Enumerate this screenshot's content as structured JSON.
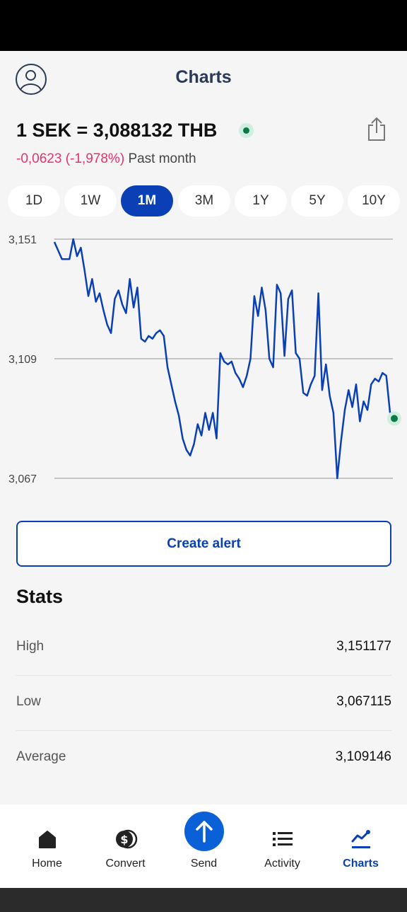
{
  "header": {
    "title": "Charts"
  },
  "rate": {
    "text": "1 SEK = 3,088132 THB",
    "change": "-0,0623 (-1,978%)",
    "period": "Past month",
    "change_color": "#e8336a",
    "live_color": "#0b7a45"
  },
  "range_tabs": [
    {
      "label": "1D",
      "active": false
    },
    {
      "label": "1W",
      "active": false
    },
    {
      "label": "1M",
      "active": true
    },
    {
      "label": "3M",
      "active": false
    },
    {
      "label": "1Y",
      "active": false
    },
    {
      "label": "5Y",
      "active": false
    },
    {
      "label": "10Y",
      "active": false
    }
  ],
  "chart_data": {
    "type": "line",
    "title": "",
    "xlabel": "",
    "ylabel": "",
    "ylim": [
      3.067,
      3.151
    ],
    "y_ticks": [
      "3,151",
      "3,109",
      "3,067"
    ],
    "y_tick_values": [
      3.151,
      3.109,
      3.067
    ],
    "grid": true,
    "line_color": "#0a3fb5",
    "series": [
      {
        "values": [
          3.15,
          3.147,
          3.144,
          3.144,
          3.144,
          3.151,
          3.145,
          3.148,
          3.14,
          3.131,
          3.137,
          3.129,
          3.132,
          3.126,
          3.121,
          3.118,
          3.13,
          3.133,
          3.128,
          3.125,
          3.137,
          3.127,
          3.134,
          3.116,
          3.115,
          3.117,
          3.116,
          3.118,
          3.119,
          3.117,
          3.106,
          3.1,
          3.094,
          3.089,
          3.081,
          3.077,
          3.075,
          3.079,
          3.086,
          3.082,
          3.09,
          3.084,
          3.09,
          3.081,
          3.111,
          3.108,
          3.107,
          3.108,
          3.104,
          3.102,
          3.099,
          3.103,
          3.109,
          3.131,
          3.124,
          3.134,
          3.126,
          3.109,
          3.106,
          3.135,
          3.132,
          3.11,
          3.13,
          3.133,
          3.111,
          3.109,
          3.097,
          3.096,
          3.1,
          3.103,
          3.132,
          3.098,
          3.107,
          3.096,
          3.09,
          3.067,
          3.08,
          3.091,
          3.098,
          3.092,
          3.1,
          3.087,
          3.094,
          3.091,
          3.1,
          3.102,
          3.101,
          3.104,
          3.103,
          3.09
        ]
      }
    ],
    "last_value": 3.088
  },
  "alert": {
    "label": "Create alert"
  },
  "stats": {
    "title": "Stats",
    "rows": [
      {
        "label": "High",
        "value": "3,151177"
      },
      {
        "label": "Low",
        "value": "3,067115"
      },
      {
        "label": "Average",
        "value": "3,109146"
      }
    ]
  },
  "nav": {
    "items": [
      {
        "label": "Home",
        "icon": "home-icon",
        "active": false
      },
      {
        "label": "Convert",
        "icon": "dollar-coins-icon",
        "active": false
      },
      {
        "label": "Send",
        "icon": "arrow-up-icon",
        "active": false
      },
      {
        "label": "Activity",
        "icon": "list-icon",
        "active": false
      },
      {
        "label": "Charts",
        "icon": "chart-icon",
        "active": true
      }
    ],
    "active_color": "#0a3fb5"
  }
}
